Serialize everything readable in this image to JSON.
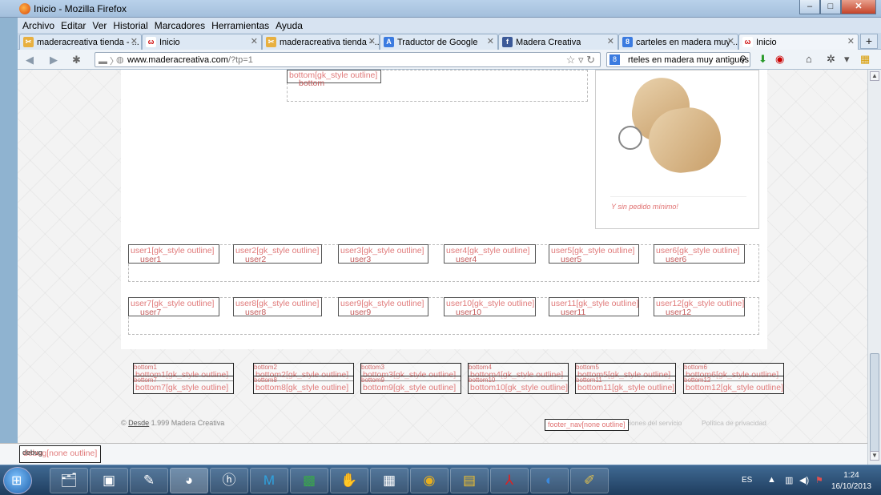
{
  "window": {
    "title": "Inicio - Mozilla Firefox",
    "min": "–",
    "max": "□",
    "close": "✕"
  },
  "menu": [
    "Archivo",
    "Editar",
    "Ver",
    "Historial",
    "Marcadores",
    "Herramientas",
    "Ayuda"
  ],
  "tabs": [
    {
      "label": "maderacreativa tienda - ...",
      "icon": "madera-icon"
    },
    {
      "label": "Inicio",
      "icon": "joomla-icon"
    },
    {
      "label": "maderacreativa tienda - ...",
      "icon": "madera-icon"
    },
    {
      "label": "Traductor de Google",
      "icon": "translate-icon"
    },
    {
      "label": "Madera Creativa",
      "icon": "facebook-icon"
    },
    {
      "label": "carteles en madera muy ...",
      "icon": "google-icon"
    },
    {
      "label": "Inicio",
      "icon": "joomla-icon"
    }
  ],
  "nav": {
    "url_host": "www.maderacreativa.com",
    "url_path": "/?tp=1",
    "search_query": "rteles en madera muy antiguos"
  },
  "page": {
    "bottom_box": {
      "title": "bottom[gk_style outline]",
      "name": "bottom"
    },
    "caption": "Y sin pedido mínimo!",
    "user_rows": [
      [
        {
          "title": "user1[gk_style outline]",
          "name": "user1"
        },
        {
          "title": "user2[gk_style outline]",
          "name": "user2"
        },
        {
          "title": "user3[gk_style outline]",
          "name": "user3"
        },
        {
          "title": "user4[gk_style outline]",
          "name": "user4"
        },
        {
          "title": "user5[gk_style outline]",
          "name": "user5"
        },
        {
          "title": "user6[gk_style outline]",
          "name": "user6"
        }
      ],
      [
        {
          "title": "user7[gk_style outline]",
          "name": "user7"
        },
        {
          "title": "user8[gk_style outline]",
          "name": "user8"
        },
        {
          "title": "user9[gk_style outline]",
          "name": "user9"
        },
        {
          "title": "user10[gk_style outline]",
          "name": "user10"
        },
        {
          "title": "user11[gk_style outline]",
          "name": "user11"
        },
        {
          "title": "user12[gk_style outline]",
          "name": "user12"
        }
      ]
    ],
    "bottom_rows": [
      [
        {
          "small": "bottom1",
          "big": "bottom1[gk_style outline]"
        },
        {
          "small": "bottom2",
          "big": "bottom2[gk_style outline]"
        },
        {
          "small": "bottom3",
          "big": "bottom3[gk_style outline]"
        },
        {
          "small": "bottom4",
          "big": "bottom4[gk_style outline]"
        },
        {
          "small": "bottom5",
          "big": "bottom5[gk_style outline]"
        },
        {
          "small": "bottom6",
          "big": "bottom6[gk_style outline]"
        }
      ],
      [
        {
          "small": "bottom7",
          "big": "bottom7[gk_style outline]"
        },
        {
          "small": "bottom8",
          "big": "bottom8[gk_style outline]"
        },
        {
          "small": "bottom9",
          "big": "bottom9[gk_style outline]"
        },
        {
          "small": "bottom10",
          "big": "bottom10[gk_style outline]"
        },
        {
          "small": "bottom11",
          "big": "bottom11[gk_style outline]"
        },
        {
          "small": "bottom12",
          "big": "bottom12[gk_style outline]"
        }
      ]
    ],
    "footer": {
      "copyright_prefix": "©",
      "desde": "Desde",
      "copyright_rest": " 1.999 Madera Creativa",
      "terms": "iciones del servicio",
      "privacy": "Política de privacidad",
      "footer_nav": "footer_nav[none outline]"
    },
    "debug": {
      "label": "debug[none outline]",
      "name": "debug"
    }
  },
  "taskbar": {
    "lang": "ES",
    "time": "1:24",
    "date": "16/10/2013"
  }
}
